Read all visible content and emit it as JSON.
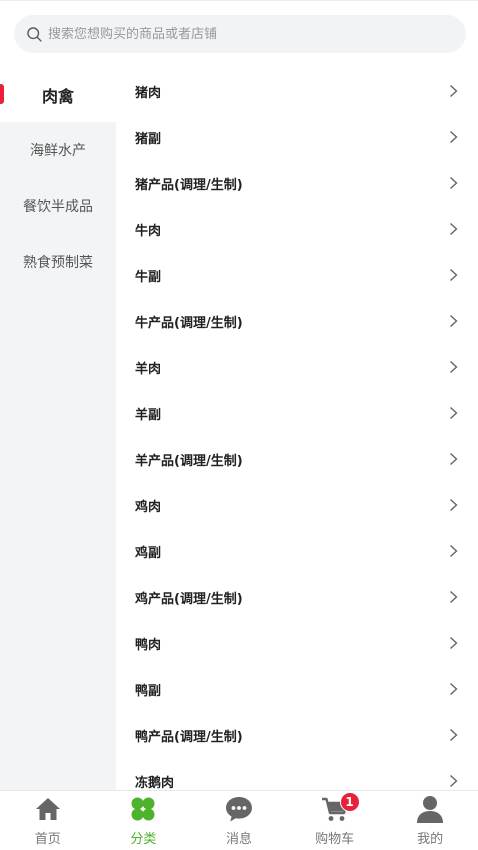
{
  "search": {
    "placeholder": "搜索您想购买的商品或者店铺"
  },
  "sidebar": {
    "items": [
      {
        "label": "肉禽",
        "active": true
      },
      {
        "label": "海鲜水产"
      },
      {
        "label": "餐饮半成品"
      },
      {
        "label": "熟食预制菜"
      }
    ]
  },
  "list": {
    "items": [
      "猪肉",
      "猪副",
      "猪产品(调理/生制)",
      "牛肉",
      "牛副",
      "牛产品(调理/生制)",
      "羊肉",
      "羊副",
      "羊产品(调理/生制)",
      "鸡肉",
      "鸡副",
      "鸡产品(调理/生制)",
      "鸭肉",
      "鸭副",
      "鸭产品(调理/生制)",
      "冻鹅肉"
    ]
  },
  "tabbar": {
    "tabs": [
      {
        "label": "首页",
        "icon": "home-icon"
      },
      {
        "label": "分类",
        "icon": "clover-icon",
        "active": true
      },
      {
        "label": "消息",
        "icon": "chat-icon"
      },
      {
        "label": "购物车",
        "icon": "cart-icon",
        "badge": "1"
      },
      {
        "label": "我的",
        "icon": "user-icon"
      }
    ]
  },
  "colors": {
    "accent": "#4cb32a",
    "indicator": "#e8203a",
    "badge": "#e8203a",
    "sidebar_bg": "#f3f4f6",
    "icon_gray": "#666666"
  }
}
